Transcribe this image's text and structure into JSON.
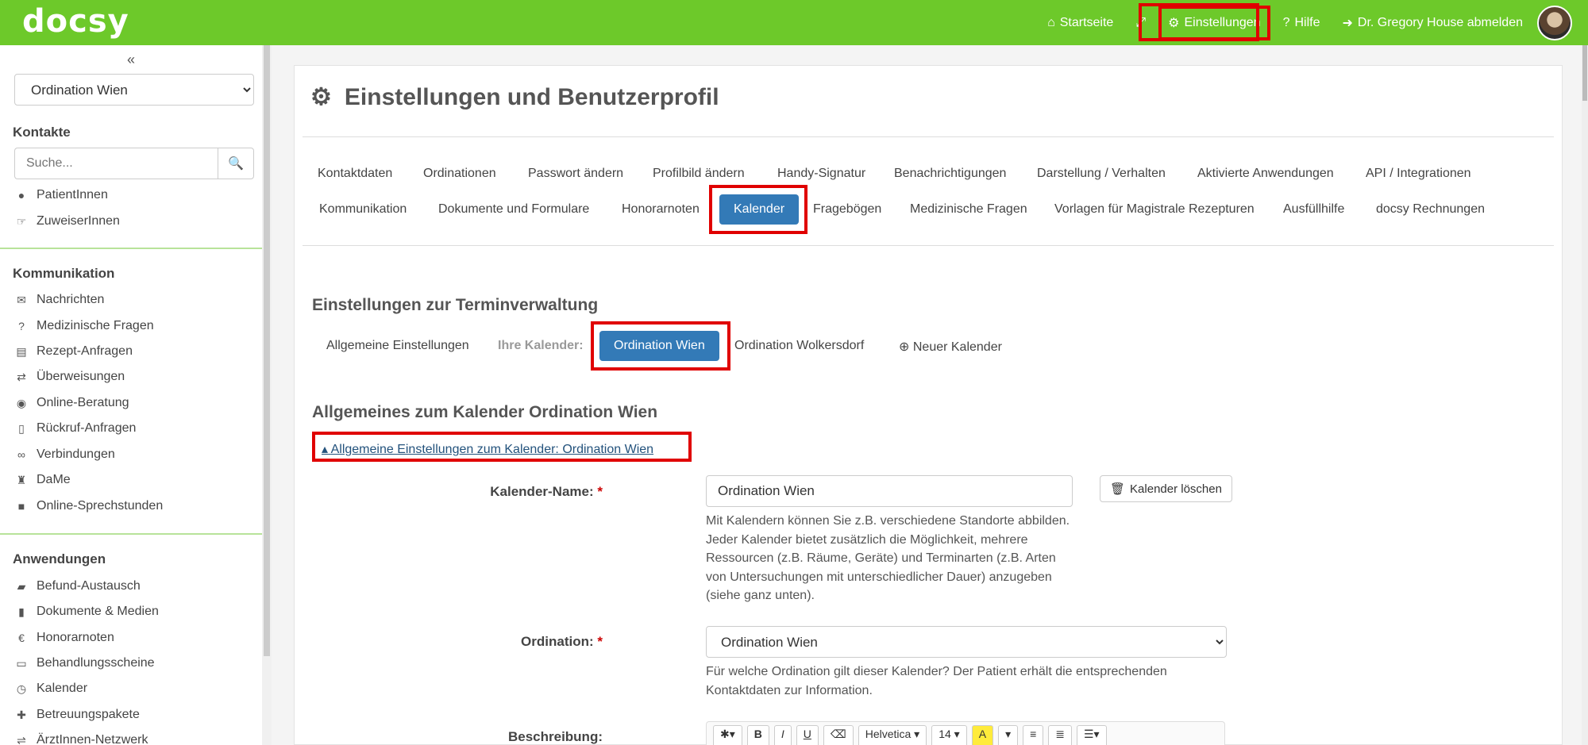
{
  "brand": {
    "logo": "docsy",
    "accent": "#6dc92a",
    "primary": "#337ab7",
    "highlight": "#e00000"
  },
  "topnav": {
    "home": "Startseite",
    "settings": "Einstellungen",
    "help": "Hilfe",
    "logout": "Dr. Gregory House abmelden"
  },
  "sidebar": {
    "practice_select": "Ordination Wien",
    "contacts_heading": "Kontakte",
    "search_placeholder": "Suche...",
    "contacts": [
      {
        "label": "PatientInnen",
        "icon": "user-icon"
      },
      {
        "label": "ZuweiserInnen",
        "icon": "referral-icon"
      }
    ],
    "communication_heading": "Kommunikation",
    "communication": [
      {
        "label": "Nachrichten",
        "icon": "envelope-icon"
      },
      {
        "label": "Medizinische Fragen",
        "icon": "question-icon"
      },
      {
        "label": "Rezept-Anfragen",
        "icon": "prescription-icon"
      },
      {
        "label": "Überweisungen",
        "icon": "transfer-icon"
      },
      {
        "label": "Online-Beratung",
        "icon": "globe-icon"
      },
      {
        "label": "Rückruf-Anfragen",
        "icon": "phone-icon"
      },
      {
        "label": "Verbindungen",
        "icon": "link-icon"
      },
      {
        "label": "DaMe",
        "icon": "dame-icon"
      },
      {
        "label": "Online-Sprechstunden",
        "icon": "video-icon"
      }
    ],
    "apps_heading": "Anwendungen",
    "apps": [
      {
        "label": "Befund-Austausch",
        "icon": "folder-icon"
      },
      {
        "label": "Dokumente & Medien",
        "icon": "file-icon"
      },
      {
        "label": "Honorarnoten",
        "icon": "euro-icon"
      },
      {
        "label": "Behandlungsscheine",
        "icon": "inbox-icon"
      },
      {
        "label": "Kalender",
        "icon": "clock-icon"
      },
      {
        "label": "Betreuungspakete",
        "icon": "gift-icon"
      },
      {
        "label": "ÄrztInnen-Netzwerk",
        "icon": "network-icon"
      }
    ]
  },
  "page": {
    "title": "Einstellungen und Benutzerprofil",
    "tabs_row1": [
      "Kontaktdaten",
      "Ordinationen",
      "Passwort ändern",
      "Profilbild ändern",
      "Handy-Signatur",
      "Benachrichtigungen",
      "Darstellung / Verhalten",
      "Aktivierte Anwendungen",
      "API / Integrationen"
    ],
    "tabs_row2": [
      "Kommunikation",
      "Dokumente und Formulare",
      "Honorarnoten",
      "Kalender",
      "Fragebögen",
      "Medizinische Fragen",
      "Vorlagen für Magistrale Rezepturen",
      "Ausfüllhilfe",
      "docsy Rechnungen"
    ],
    "active_tab": "Kalender",
    "section_title": "Einstellungen zur Terminverwaltung",
    "subtabs": {
      "general": "Allgemeine Einstellungen",
      "your_calendars": "Ihre Kalender:",
      "cal1": "Ordination Wien",
      "cal2": "Ordination Wolkersdorf",
      "new": "Neuer Kalender"
    },
    "calendar_heading": "Allgemeines zum Kalender Ordination Wien",
    "collapse_link": "Allgemeine Einstellungen zum Kalender: Ordination Wien",
    "form": {
      "name_label": "Kalender-Name:",
      "name_value": "Ordination Wien",
      "delete_button": "Kalender löschen",
      "name_help": "Mit Kalendern können Sie z.B. verschiedene Standorte abbilden. Jeder Kalender bietet zusätzlich die Möglichkeit, mehrere Ressourcen (z.B. Räume, Geräte) und Terminarten (z.B. Arten von Untersuchungen mit unterschiedlicher Dauer) anzugeben (siehe ganz unten).",
      "practice_label": "Ordination:",
      "practice_value": "Ordination Wien",
      "practice_help": "Für welche Ordination gilt dieser Kalender? Der Patient erhält die entsprechenden Kontaktdaten zur Information.",
      "description_label": "Beschreibung:",
      "editor": {
        "font": "Helvetica",
        "size": "14"
      }
    }
  }
}
